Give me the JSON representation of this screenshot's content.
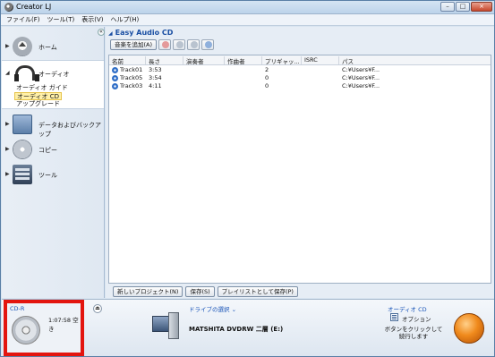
{
  "window": {
    "title": "Creator LJ",
    "controls": [
      "–",
      "□",
      "×"
    ]
  },
  "menu": [
    "ファイル(F)",
    "ツール(T)",
    "表示(V)",
    "ヘルプ(H)"
  ],
  "sidebar": {
    "collapse": "«",
    "items": [
      {
        "label": "ホーム",
        "icon": "home-icon"
      },
      {
        "label": "オーディオ",
        "icon": "headphone-icon"
      },
      {
        "label": "データおよびバックアップ",
        "icon": "backup-icon"
      },
      {
        "label": "コピー",
        "icon": "copy-icon"
      },
      {
        "label": "ツール",
        "icon": "tool-icon"
      }
    ],
    "audio_sub": [
      "オーディオ ガイド",
      "オーディオ CD",
      "アップグレード"
    ]
  },
  "main": {
    "title": "Easy Audio CD",
    "add_music": "音楽を追加(A)",
    "columns": [
      "名前",
      "長さ",
      "演奏者",
      "作曲者",
      "プリギャッ...",
      "ISRC",
      "パス"
    ],
    "rows": [
      [
        "Track01",
        "3:53",
        "",
        "",
        "2",
        "",
        "C:¥Users¥F..."
      ],
      [
        "Track05",
        "3:54",
        "",
        "",
        "0",
        "",
        "C:¥Users¥F..."
      ],
      [
        "Track03",
        "4:11",
        "",
        "",
        "0",
        "",
        "C:¥Users¥F..."
      ]
    ],
    "new_project": "新しいプロジェクト(N)",
    "save": "保存(S)",
    "save_playlist": "プレイリストとして保存(P)"
  },
  "footer": {
    "media_type": "CD-R",
    "free_space": "1:07:58 空き",
    "drive_label": "ドライブの選択",
    "drive_name": "MATSHITA DVDRW 二層 (E:)",
    "mode": "オーディオ CD",
    "options": "オプション",
    "hint_line1": "ボタンをクリックして",
    "hint_line2": "続行します"
  },
  "colors": {
    "accent": "#1a55b8",
    "highlight_box": "#e3150f",
    "go_button": "#f08a1c"
  }
}
